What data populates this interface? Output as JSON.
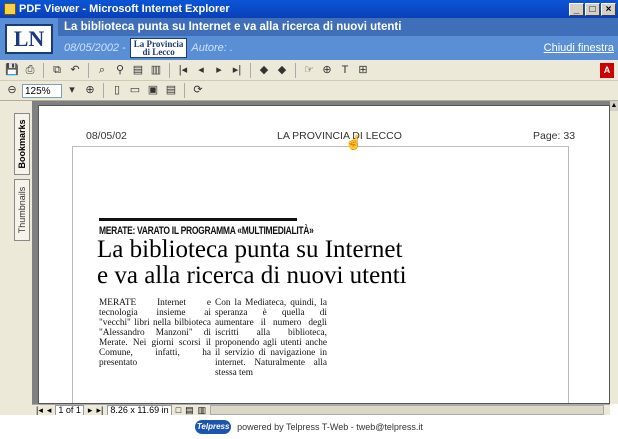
{
  "window": {
    "title": "PDF Viewer - Microsoft Internet Explorer"
  },
  "header": {
    "logo": "LN",
    "headline": "La biblioteca punta su Internet e va alla ricerca di nuovi utenti",
    "date": "08/05/2002 -",
    "masthead_line1": "La Provincia",
    "masthead_line2": "di Lecco",
    "author_label": "Autore: .",
    "close_link": "Chiudi finestra"
  },
  "toolbar": {
    "zoom_value": "125%",
    "adobe_logo": "A"
  },
  "sidebar": {
    "tab_bookmarks": "Bookmarks",
    "tab_thumbnails": "Thumbnails"
  },
  "page": {
    "date": "08/05/02",
    "newspaper": "LA PROVINCIA DI LECCO",
    "page_no": "Page: 33"
  },
  "article": {
    "kicker": "MERATE: VARATO IL PROGRAMMA «MULTIMEDIALITÀ»",
    "headline_line1": "La biblioteca punta su Internet",
    "headline_line2": "e va alla ricerca di nuovi utenti",
    "col1": "MERATE Internet e tecnologia insieme ai \"vecchi\" libri nella bilbioteca \"Alessandro Manzoni\" di Merate. Nei giorni scorsi il Comune, infatti, ha presentato",
    "col2": "Con la Mediateca, quindi, la speranza è quella di aumentare il numero degli iscritti alla biblioteca, proponendo agli utenti anche il servizio di navigazione in internet. Naturalmente alla stessa tem"
  },
  "status": {
    "page_count": "1 of 1",
    "page_size": "8.26 x 11.69 in"
  },
  "footer": {
    "logo_text": "Telpress",
    "text": "powered by Telpress T-Web - tweb@telpress.it"
  }
}
